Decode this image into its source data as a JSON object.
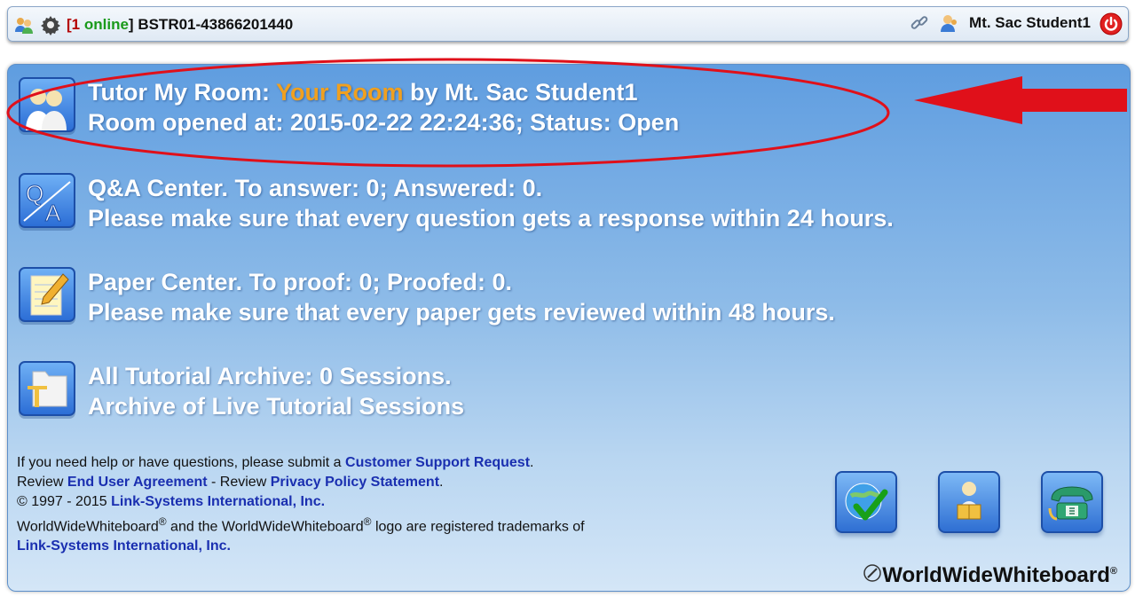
{
  "topbar": {
    "bracket_open": "[",
    "online_count": "1",
    "online_label": " online",
    "bracket_close": "] ",
    "room_id": "BSTR01-43866201440",
    "user_name": "Mt. Sac Student1",
    "icons": [
      "users-icon",
      "gear-icon",
      "link-icon",
      "user-icon",
      "power-icon"
    ]
  },
  "items": [
    {
      "icon": "tutor-room-icon",
      "line1_prefix": "Tutor My Room: ",
      "line1_highlight": "Your Room",
      "line1_suffix": " by Mt. Sac Student1",
      "line2": "Room opened at: 2015-02-22 22:24:36; Status: Open"
    },
    {
      "icon": "qa-icon",
      "line1": "Q&A Center. To answer: 0; Answered: 0.",
      "line2": "Please make sure that every question gets a response within 24 hours."
    },
    {
      "icon": "paper-icon",
      "line1": "Paper Center. To proof: 0; Proofed: 0.",
      "line2": "Please make sure that every paper gets reviewed within 48 hours."
    },
    {
      "icon": "archive-folder-icon",
      "line1": "All Tutorial Archive: 0 Sessions.",
      "line2": "Archive of Live Tutorial Sessions"
    }
  ],
  "footer": {
    "help_text": "If you need help or have questions, please submit a ",
    "support_link": "Customer Support Request",
    "period": ".",
    "review1": "Review ",
    "eula_link": "End User Agreement",
    "review2": " - Review ",
    "privacy_link": "Privacy Policy Statement",
    "period2": ".",
    "copyright": "© 1997 - 2015 ",
    "company_link": "Link-Systems International, Inc.",
    "tm_part1": "WorldWideWhiteboard",
    "reg": "®",
    "tm_part2": " and the WorldWideWhiteboard",
    "tm_part3": " logo are registered trademarks of",
    "company_link2": "Link-Systems International, Inc."
  },
  "bottom_icons": [
    "globe-check-icon",
    "reader-icon",
    "telephone-icon"
  ],
  "brand": {
    "name": "WorldWideWhiteboard",
    "mark": "®"
  },
  "colors": {
    "highlight": "#f0a020",
    "online": "#1a9a1a",
    "link": "#1a2fb0",
    "annotation": "#e0101a"
  }
}
